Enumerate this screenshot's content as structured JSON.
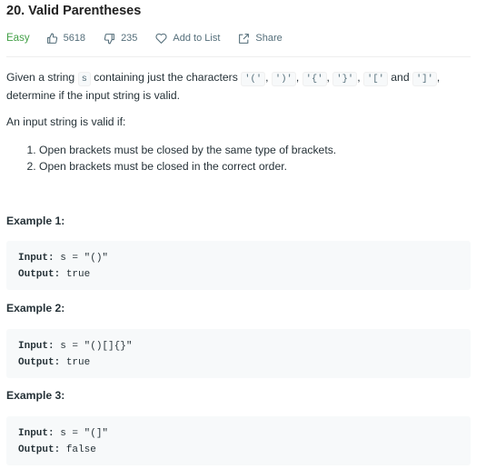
{
  "problem": {
    "title": "20. Valid Parentheses",
    "difficulty": "Easy",
    "likes": "5618",
    "dislikes": "235",
    "add_to_list": "Add to List",
    "share": "Share",
    "colors": {
      "easy": "#43a047",
      "meta": "#546e7a",
      "code_bg": "#f7f9fa"
    }
  },
  "description": {
    "given_a_string": "Given a string",
    "s_var": "s",
    "containing_chars": "containing just the characters",
    "ch1": "'('",
    "ch2": "')'",
    "ch3": "'{'",
    "ch4": "'}'",
    "ch5": "'['",
    "and": "and",
    "ch6": "']'",
    "comma": ",",
    "line2": "determine if the input string is valid.",
    "valid_if": "An input string is valid if:",
    "rules": [
      "Open brackets must be closed by the same type of brackets.",
      "Open brackets must be closed in the correct order."
    ]
  },
  "examples": [
    {
      "heading": "Example 1:",
      "input_label": "Input:",
      "input_value": " s = \"()\"",
      "output_label": "Output:",
      "output_value": " true"
    },
    {
      "heading": "Example 2:",
      "input_label": "Input:",
      "input_value": " s = \"()[]{}\"",
      "output_label": "Output:",
      "output_value": " true"
    },
    {
      "heading": "Example 3:",
      "input_label": "Input:",
      "input_value": " s = \"(]\"",
      "output_label": "Output:",
      "output_value": " false"
    }
  ]
}
